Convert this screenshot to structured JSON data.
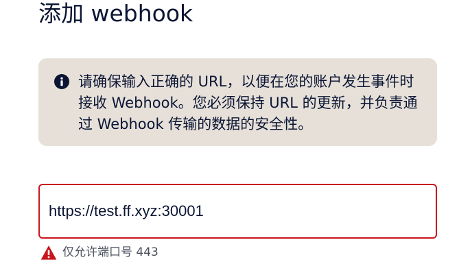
{
  "page": {
    "title": "添加 webhook"
  },
  "notice": {
    "icon": "info-icon",
    "text": "请确保输入正确的 URL，以便在您的账户发生事件时接收 Webhook。您必须保持 URL 的更新，并负责通过 Webhook 传输的数据的安全性。"
  },
  "url_field": {
    "value": "https://test.ff.xyz:30001",
    "border_color": "#c8161d"
  },
  "error": {
    "icon": "warning-icon",
    "text": "仅允许端口号 443",
    "color": "#c8161d"
  },
  "colors": {
    "text_primary": "#0b1533",
    "notice_bg": "#e6e0d9"
  }
}
